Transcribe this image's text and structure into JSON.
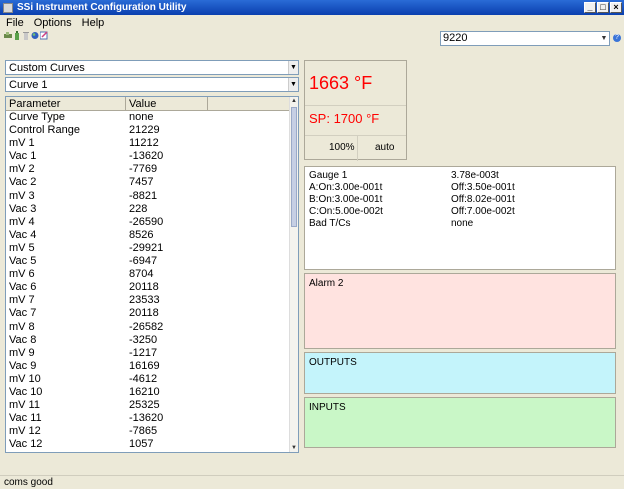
{
  "window": {
    "title": "SSi Instrument Configuration Utility"
  },
  "menu": {
    "items": [
      "File",
      "Options",
      "Help"
    ]
  },
  "toolbar": {
    "port_value": "9220"
  },
  "left": {
    "curve_type_select": "Custom Curves",
    "curve_select": "Curve 1",
    "grid": {
      "headers": [
        "Parameter",
        "Value"
      ],
      "rows": [
        [
          "Curve Type",
          "none"
        ],
        [
          "Control Range",
          "21229"
        ],
        [
          "mV 1",
          "11212"
        ],
        [
          "Vac 1",
          "-13620"
        ],
        [
          "mV 2",
          "-7769"
        ],
        [
          "Vac 2",
          "7457"
        ],
        [
          "mV 3",
          "-8821"
        ],
        [
          "Vac 3",
          "228"
        ],
        [
          "mV 4",
          "-26590"
        ],
        [
          "Vac 4",
          "8526"
        ],
        [
          "mV 5",
          "-29921"
        ],
        [
          "Vac 5",
          "-6947"
        ],
        [
          "mV 6",
          "8704"
        ],
        [
          "Vac 6",
          "20118"
        ],
        [
          "mV 7",
          "23533"
        ],
        [
          "Vac 7",
          "20118"
        ],
        [
          "mV 8",
          "-26582"
        ],
        [
          "Vac 8",
          "-3250"
        ],
        [
          "mV 9",
          "-1217"
        ],
        [
          "Vac 9",
          "16169"
        ],
        [
          "mV 10",
          "-4612"
        ],
        [
          "Vac 10",
          "16210"
        ],
        [
          "mV 11",
          "25325"
        ],
        [
          "Vac 11",
          "-13620"
        ],
        [
          "mV 12",
          "-7865"
        ],
        [
          "Vac 12",
          "1057"
        ]
      ]
    }
  },
  "status_display": {
    "temperature": "1663 °F",
    "setpoint": "SP: 1700 °F",
    "output_pct": "100%",
    "mode": "auto"
  },
  "gauge": {
    "rows": [
      [
        "Gauge 1",
        "3.78e-003t"
      ],
      [
        "A:On:3.00e-001t",
        "Off:3.50e-001t"
      ],
      [
        "B:On:3.00e-001t",
        "Off:8.02e-001t"
      ],
      [
        "C:On:5.00e-002t",
        "Off:7.00e-002t"
      ],
      [
        "Bad T/Cs",
        "none"
      ]
    ]
  },
  "panels": {
    "alarm": "Alarm 2",
    "outputs": "OUTPUTS",
    "inputs": "INPUTS"
  },
  "statusbar": {
    "text": "coms good"
  },
  "colors": {
    "temp": "#ff0000",
    "alarm_bg": "#ffe3e0",
    "outputs_bg": "#c4f4fb",
    "inputs_bg": "#c9f7c7"
  }
}
